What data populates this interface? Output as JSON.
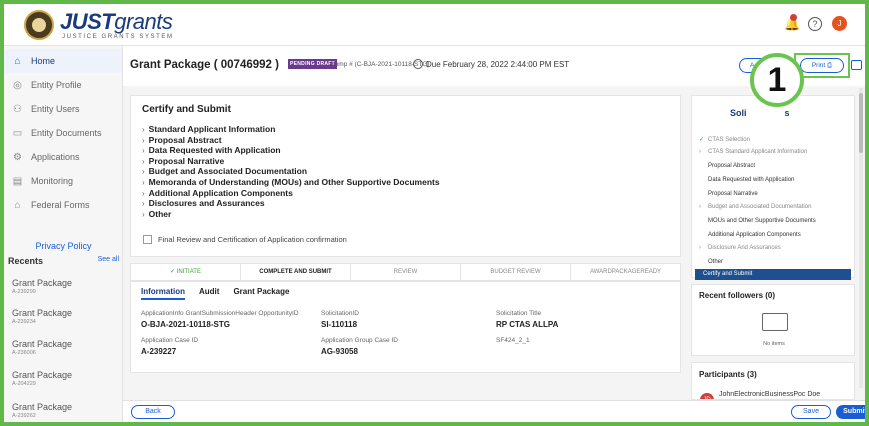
{
  "header": {
    "logo_main": "JUST",
    "logo_accent": "grants",
    "logo_sub": "JUSTICE GRANTS SYSTEM",
    "help_glyph": "?",
    "user_initial": "J"
  },
  "sidebar": {
    "items": [
      {
        "label": "Home",
        "icon": "home-icon"
      },
      {
        "label": "Entity Profile",
        "icon": "globe-icon"
      },
      {
        "label": "Entity Users",
        "icon": "users-icon"
      },
      {
        "label": "Entity Documents",
        "icon": "document-icon"
      },
      {
        "label": "Applications",
        "icon": "applications-icon"
      },
      {
        "label": "Monitoring",
        "icon": "monitoring-icon"
      },
      {
        "label": "Federal Forms",
        "icon": "bank-icon"
      }
    ],
    "privacy": "Privacy Policy",
    "recents_title": "Recents",
    "see_all": "See all",
    "recents": [
      {
        "title": "Grant Package",
        "sub": "A-239299"
      },
      {
        "title": "Grant Package",
        "sub": "A-239234"
      },
      {
        "title": "Grant Package",
        "sub": "A-236006"
      },
      {
        "title": "Grant Package",
        "sub": "A-204229"
      },
      {
        "title": "Grant Package",
        "sub": "A-239262"
      }
    ]
  },
  "titlebar": {
    "title": "Grant Package  ( 00746992 )",
    "badge": "PENDING DRAFT",
    "comp": "Comp # (C-BJA-2021-10118-STG)",
    "due": "Due  February 28, 2022 2:44:00 PM EST",
    "actions": "Actions ∨",
    "print": "Print ⎙",
    "callout": "1"
  },
  "certify": {
    "title": "Certify and Submit",
    "sections": [
      "Standard Applicant Information",
      "Proposal Abstract",
      "Data Requested with Application",
      "Proposal Narrative",
      "Budget and Associated Documentation",
      "Memoranda of Understanding (MOUs) and Other Supportive Documents",
      "Additional Application Components",
      "Disclosures and Assurances",
      "Other"
    ],
    "final_review": "Final Review and Certification of Application confirmation"
  },
  "progress": {
    "steps": [
      "✓  INITIATE",
      "COMPLETE AND SUBMIT",
      "REVIEW",
      "BUDGET REVIEW",
      "AWARDPACKAGEREADY"
    ]
  },
  "info": {
    "tabs": [
      "Information",
      "Audit",
      "Grant Package"
    ],
    "fields": [
      {
        "label": "ApplicationInfo GrantSubmissionHeader OpportunityID",
        "value": "O-BJA-2021-10118-STG"
      },
      {
        "label": "SolicitationID",
        "value": "SI-110118"
      },
      {
        "label": "Solicitation Title",
        "value": "RP CTAS ALLPA"
      },
      {
        "label": "Application Case ID",
        "value": "A-239227"
      },
      {
        "label": "Application Group Case ID",
        "value": "AG-93058"
      },
      {
        "label": "SF424_2_1",
        "value": ""
      }
    ]
  },
  "bottom": {
    "back": "Back",
    "save": "Save",
    "submit": "Submit"
  },
  "solicitation": {
    "title": "Soli",
    "title_end": "s",
    "items": [
      {
        "label": "CTAS Selection",
        "mark": "✓",
        "grey": true
      },
      {
        "label": "CTAS Standard Applicant Information",
        "mark": "›",
        "grey": true
      },
      {
        "label": "Proposal Abstract",
        "mark": "",
        "grey": false
      },
      {
        "label": "Data Requested with Application",
        "mark": "",
        "grey": false
      },
      {
        "label": "Proposal Narrative",
        "mark": "",
        "grey": false
      },
      {
        "label": "Budget and Associated Documentation",
        "mark": "›",
        "grey": true
      },
      {
        "label": "MOUs and Other Supportive Documents",
        "mark": "",
        "grey": false
      },
      {
        "label": "Additional Application Components",
        "mark": "",
        "grey": false
      },
      {
        "label": "Disclosure And Assurances",
        "mark": "›",
        "grey": true
      },
      {
        "label": "Other",
        "mark": "",
        "grey": false
      }
    ],
    "active": "Certify and Submit"
  },
  "followers": {
    "title": "Recent followers (0)",
    "empty": "No items"
  },
  "participants": {
    "title": "Participants (3)",
    "initials": "JD",
    "name": "JohnElectronicBusinessPoc Doe"
  }
}
